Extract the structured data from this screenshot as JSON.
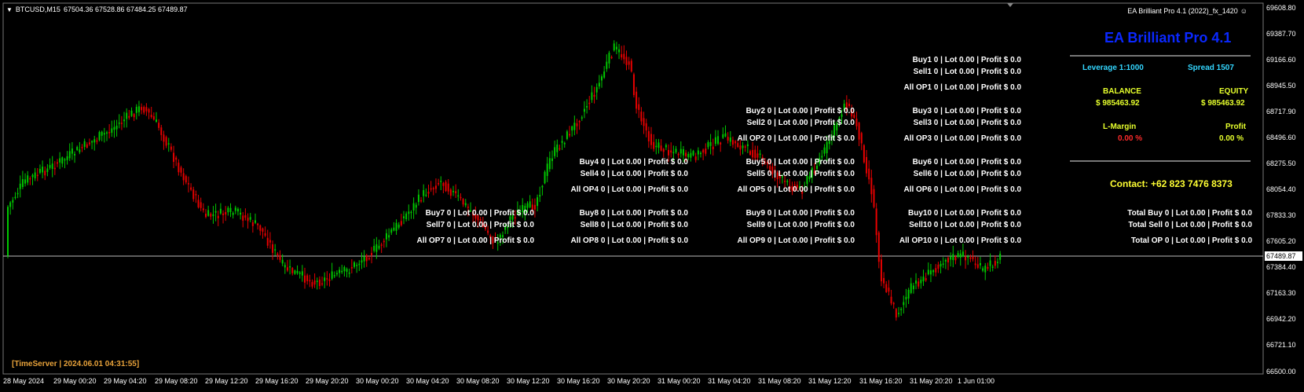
{
  "header": {
    "menu_arrow": "▼",
    "symbol_tf": "BTCUSD,M15",
    "ohlc": "67504.36 67528.86 67484.25 67489.87",
    "ea_label": "EA Brilliant Pro 4.1 (2022)_fx_1420",
    "smiley": "☺"
  },
  "colors": {
    "bull": "#00c800",
    "bear": "#e60000",
    "panel_title": "#0a28ff",
    "cyan": "#33d6ff",
    "yellowgreen": "#e6ff2c",
    "contact": "#ffff33",
    "timeserver": "#e8a23a"
  },
  "price_axis": {
    "ticks": [
      "69608.80",
      "69387.70",
      "69166.60",
      "68945.50",
      "68717.90",
      "68496.60",
      "68275.50",
      "68054.40",
      "67833.30",
      "67605.20",
      "67384.40",
      "67163.30",
      "66942.20",
      "66721.10",
      "66500.00"
    ],
    "current": "67489.87"
  },
  "time_axis": {
    "ticks": [
      "28 May 2024",
      "29 May 00:20",
      "29 May 04:20",
      "29 May 08:20",
      "29 May 12:20",
      "29 May 16:20",
      "29 May 20:20",
      "30 May 00:20",
      "30 May 04:20",
      "30 May 08:20",
      "30 May 12:20",
      "30 May 16:20",
      "30 May 20:20",
      "31 May 00:20",
      "31 May 04:20",
      "31 May 08:20",
      "31 May 12:20",
      "31 May 16:20",
      "31 May 20:20",
      "1 Jun 01:00"
    ]
  },
  "groups": [
    {
      "buy": "Buy1   0  |  Lot 0.00  |  Profit $ 0.0",
      "sell": "Sell1   0  |  Lot 0.00  |  Profit $ 0.0",
      "allop": "All OP1  0  |  Lot 0.00  |  Profit $ 0.0"
    },
    {
      "buy": "Buy2   0  |  Lot 0.00  |  Profit $ 0.0",
      "sell": "Sell2   0  |  Lot 0.00  |  Profit $ 0.0",
      "allop": "All OP2  0  |  Lot 0.00  |  Profit $ 0.0"
    },
    {
      "buy": "Buy3   0  |  Lot 0.00  |  Profit $ 0.0",
      "sell": "Sell3   0  |  Lot 0.00  |  Profit $ 0.0",
      "allop": "All OP3  0  |  Lot 0.00  |  Profit $ 0.0"
    },
    {
      "buy": "Buy4   0  |  Lot 0.00  |  Profit $ 0.0",
      "sell": "Sell4   0  |  Lot 0.00  |  Profit $ 0.0",
      "allop": "All OP4  0  |  Lot 0.00  |  Profit $ 0.0"
    },
    {
      "buy": "Buy5   0  |  Lot 0.00  |  Profit $ 0.0",
      "sell": "Sell5   0  |  Lot 0.00  |  Profit $ 0.0",
      "allop": "All OP5  0  |  Lot 0.00  |  Profit $ 0.0"
    },
    {
      "buy": "Buy6   0  |  Lot 0.00  |  Profit $ 0.0",
      "sell": "Sell6   0  |  Lot 0.00  |  Profit $ 0.0",
      "allop": "All OP6  0  |  Lot 0.00  |  Profit $ 0.0"
    },
    {
      "buy": "Buy7   0  |  Lot 0.00  |  Profit $ 0.0",
      "sell": "Sell7   0  |  Lot 0.00  |  Profit $ 0.0",
      "allop": "All OP7  0  |  Lot 0.00  |  Profit $ 0.0"
    },
    {
      "buy": "Buy8   0  |  Lot 0.00  |  Profit $ 0.0",
      "sell": "Sell8   0  |  Lot 0.00  |  Profit $ 0.0",
      "allop": "All OP8  0  |  Lot 0.00  |  Profit $ 0.0"
    },
    {
      "buy": "Buy9   0  |  Lot 0.00  |  Profit $ 0.0",
      "sell": "Sell9   0  |  Lot 0.00  |  Profit $ 0.0",
      "allop": "All OP9  0  |  Lot 0.00  |  Profit $ 0.0"
    },
    {
      "buy": "Buy10   0  |  Lot 0.00  |  Profit $ 0.0",
      "sell": "Sell10   0  |  Lot 0.00  |  Profit $ 0.0",
      "allop": "All OP10  0  |  Lot 0.00  |  Profit $ 0.0"
    }
  ],
  "totals": {
    "buy": "Total Buy   0  |  Lot 0.00  |  Profit $ 0.0",
    "sell": "Total Sell   0  |  Lot 0.00  |  Profit $ 0.0",
    "op": "Total OP   0  |  Lot 0.00  |  Profit $ 0.0"
  },
  "panel": {
    "title": "EA Brilliant Pro 4.1",
    "leverage": "Leverage  1:1000",
    "spread": "Spread   1507",
    "balance_label": "BALANCE",
    "balance_value": "$ 985463.92",
    "equity_label": "EQUITY",
    "equity_value": "$ 985463.92",
    "lmargin_label": "L-Margin",
    "lmargin_value": "0.00 %",
    "profit_label": "Profit",
    "profit_value": "0.00 %",
    "contact": "Contact: +62 823 7476 8373"
  },
  "timeserver": "[TimeServer | 2024.06.01 04:31:55]"
}
